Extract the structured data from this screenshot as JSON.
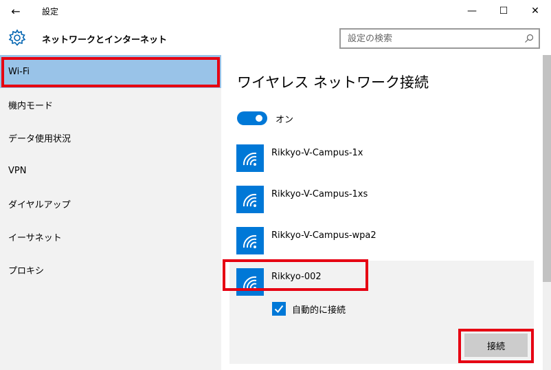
{
  "window": {
    "title": "設定",
    "back_icon": "←",
    "minimize_icon": "—",
    "maximize_icon": "☐",
    "close_icon": "✕"
  },
  "header": {
    "title": "ネットワークとインターネット",
    "search_placeholder": "設定の検索"
  },
  "sidebar": {
    "items": [
      {
        "label": "Wi-Fi",
        "selected": true
      },
      {
        "label": "機内モード"
      },
      {
        "label": "データ使用状況"
      },
      {
        "label": "VPN"
      },
      {
        "label": "ダイヤルアップ"
      },
      {
        "label": "イーサネット"
      },
      {
        "label": "プロキシ"
      }
    ]
  },
  "content": {
    "title": "ワイヤレス ネットワーク接続",
    "toggle_label": "オン",
    "networks": [
      {
        "name": "Rikkyo-V-Campus-1x"
      },
      {
        "name": "Rikkyo-V-Campus-1xs"
      },
      {
        "name": "Rikkyo-V-Campus-wpa2"
      },
      {
        "name": "Rikkyo-002"
      }
    ],
    "auto_connect_label": "自動的に接続",
    "connect_button": "接続"
  },
  "colors": {
    "accent": "#0078d7",
    "selected_nav": "#99c3e8",
    "highlight": "#e60012"
  }
}
